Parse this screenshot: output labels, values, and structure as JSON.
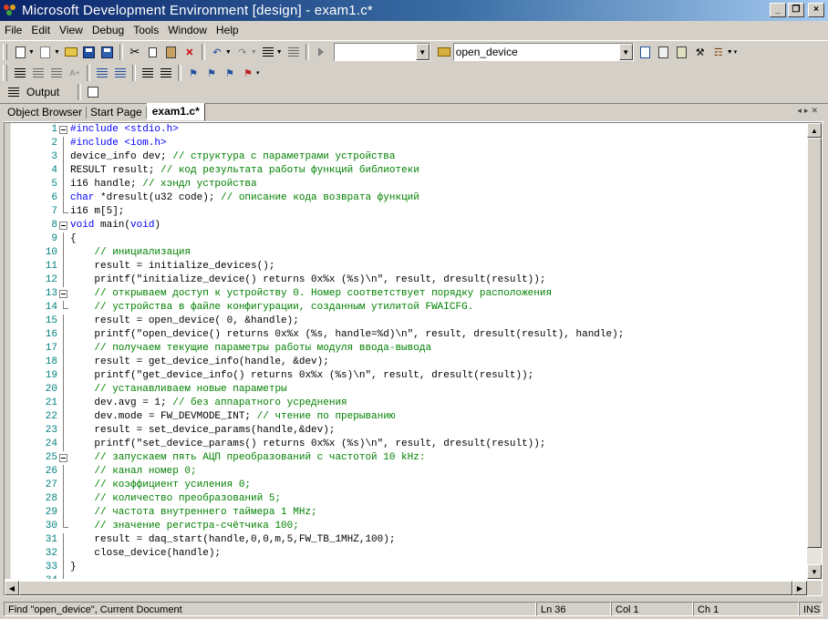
{
  "window": {
    "title": "Microsoft Development Environment [design] - exam1.c*",
    "minimize_label": "_",
    "maximize_label": "❐",
    "close_label": "×"
  },
  "menu": [
    {
      "label": "File"
    },
    {
      "label": "Edit"
    },
    {
      "label": "View"
    },
    {
      "label": "Debug"
    },
    {
      "label": "Tools"
    },
    {
      "label": "Window"
    },
    {
      "label": "Help"
    }
  ],
  "toolbar": {
    "config_combo_value": "",
    "find_combo_value": "open_device",
    "output_label": "Output"
  },
  "tabs": [
    {
      "label": "Object Browser",
      "active": false
    },
    {
      "label": "Start Page",
      "active": false
    },
    {
      "label": "exam1.c*",
      "active": true
    }
  ],
  "editor": {
    "lines": [
      {
        "n": "1",
        "fold": "open",
        "text": "#include <stdio.h>",
        "style": "pre"
      },
      {
        "n": "2",
        "fold": "line",
        "text": "#include <iom.h>",
        "style": "pre"
      },
      {
        "n": "3",
        "fold": "line",
        "code": "device_info dev; ",
        "comment": "// структура с параметрами устройства"
      },
      {
        "n": "4",
        "fold": "line",
        "code": "RESULT result; ",
        "comment": "// код результата работы функций библиотеки"
      },
      {
        "n": "5",
        "fold": "line",
        "code": "i16 handle; ",
        "comment": "// хэндл устройства"
      },
      {
        "n": "6",
        "fold": "line",
        "kw": "char",
        "code": " *dresult(u32 code); ",
        "comment": "// описание кода возврата функций"
      },
      {
        "n": "7",
        "fold": "end",
        "code": "i16 m[5];"
      },
      {
        "n": "8",
        "fold": "open",
        "kw": "void",
        "code": " main(",
        "kw2": "void",
        "code2": ")"
      },
      {
        "n": "9",
        "fold": "line",
        "code": "{"
      },
      {
        "n": "10",
        "fold": "line",
        "code": "    ",
        "comment": "// инициализация"
      },
      {
        "n": "11",
        "fold": "line",
        "code": "    result = initialize_devices();"
      },
      {
        "n": "12",
        "fold": "line",
        "code": "    printf(\"initialize_device() returns 0x%x (%s)\\n\", result, dresult(result));"
      },
      {
        "n": "13",
        "fold": "open",
        "code": "    ",
        "comment": "// открываем доступ к устройству 0. Номер соответствует порядку расположения"
      },
      {
        "n": "14",
        "fold": "end",
        "code": "    ",
        "comment": "// устройства в файле конфигурации, созданным утилитой FWAICFG."
      },
      {
        "n": "15",
        "fold": "line",
        "code": "    result = open_device( 0, &handle);"
      },
      {
        "n": "16",
        "fold": "line",
        "code": "    printf(\"open_device() returns 0x%x (%s, handle=%d)\\n\", result, dresult(result), handle);"
      },
      {
        "n": "17",
        "fold": "line",
        "code": "    ",
        "comment": "// получаем текущие параметры работы модуля ввода-вывода"
      },
      {
        "n": "18",
        "fold": "line",
        "code": "    result = get_device_info(handle, &dev);"
      },
      {
        "n": "19",
        "fold": "line",
        "code": "    printf(\"get_device_info() returns 0x%x (%s)\\n\", result, dresult(result));"
      },
      {
        "n": "20",
        "fold": "line",
        "code": "    ",
        "comment": "// устанавливаем новые параметры"
      },
      {
        "n": "21",
        "fold": "line",
        "code": "    dev.avg = 1; ",
        "comment": "// без аппаратного усреднения"
      },
      {
        "n": "22",
        "fold": "line",
        "code": "    dev.mode = FW_DEVMODE_INT; ",
        "comment": "// чтение по прерыванию"
      },
      {
        "n": "23",
        "fold": "line",
        "code": "    result = set_device_params(handle,&dev);"
      },
      {
        "n": "24",
        "fold": "line",
        "code": "    printf(\"set_device_params() returns 0x%x (%s)\\n\", result, dresult(result));"
      },
      {
        "n": "25",
        "fold": "open",
        "code": "    ",
        "comment": "// запускаем пять АЦП преобразований с частотой 10 kHz:"
      },
      {
        "n": "26",
        "fold": "line",
        "code": "    ",
        "comment": "// канал номер 0;"
      },
      {
        "n": "27",
        "fold": "line",
        "code": "    ",
        "comment": "// коэффициент усиления 0;"
      },
      {
        "n": "28",
        "fold": "line",
        "code": "    ",
        "comment": "// количество преобразований 5;"
      },
      {
        "n": "29",
        "fold": "line",
        "code": "    ",
        "comment": "// частота внутреннего таймера 1 MHz;"
      },
      {
        "n": "30",
        "fold": "end",
        "code": "    ",
        "comment": "// значение регистра-счётчика 100;"
      },
      {
        "n": "31",
        "fold": "line",
        "code": "    result = daq_start(handle,0,0,m,5,FW_TB_1MHZ,100);"
      },
      {
        "n": "32",
        "fold": "line",
        "code": "    close_device(handle);"
      },
      {
        "n": "33",
        "fold": "line",
        "code": "}"
      },
      {
        "n": "34",
        "fold": "line",
        "code": ""
      }
    ]
  },
  "status": {
    "message": "Find \"open_device\", Current Document",
    "line": "Ln 36",
    "col": "Col 1",
    "ch": "Ch 1",
    "mode": "INS"
  },
  "colors": {
    "keyword": "#0000ff",
    "comment": "#008000",
    "line_number": "#008080",
    "title_gradient_start": "#0a246a"
  }
}
